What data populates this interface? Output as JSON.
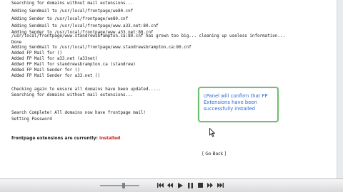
{
  "log": [
    "Searching for domains without mail extensions...",
    "Adding Sendmail to /usr/local/frontpage/we80.cnf",
    "Adding Sender to /usr/local/frontpage/we80.cnf",
    "Adding Sendmail to /usr/local/frontpage/www.a33.net:80.cnf",
    "Adding Sender to /usr/local/frontpage/www.a33.net:80.cnf",
    "/usr/local/frontpage/www.standrewsbrampton.ca:80.cnf has grown too big... cleaning up useless information...",
    "Done",
    "Adding Sendmail to /usr/local/frontpage/www.standrewsbrampton.ca:80.cnf",
    "Added FP Mail for ()",
    "Added FP Mail for a33.net (a33net)",
    "Added FP Mail for standrewsbrampton.ca (standrew)",
    "Added FP Mail Sender for ()",
    "Added FP Mail Sender for a33.net ()",
    "",
    "Checking again to ensure all domains have been updated.....",
    "Searching for domains without mail extensions...",
    "",
    "",
    "Search Complete! All domains now have frontpage mail!",
    "Setting Password"
  ],
  "status": {
    "label": "frontpage extensions are currently:",
    "value": "installed",
    "value_color": "#d11a1a"
  },
  "back": {
    "open": "[",
    "label": "Go Back",
    "close": "]"
  },
  "callout": {
    "text": "cPanel will confirm that FP Extensions have been successfully installed",
    "border_color": "#6ec06e",
    "text_color": "#2a6ad6"
  },
  "player": {
    "controls": [
      "rewind-icon",
      "step-back-icon",
      "play-icon",
      "pause-icon",
      "stop-icon",
      "step-forward-icon",
      "fast-forward-icon"
    ]
  }
}
